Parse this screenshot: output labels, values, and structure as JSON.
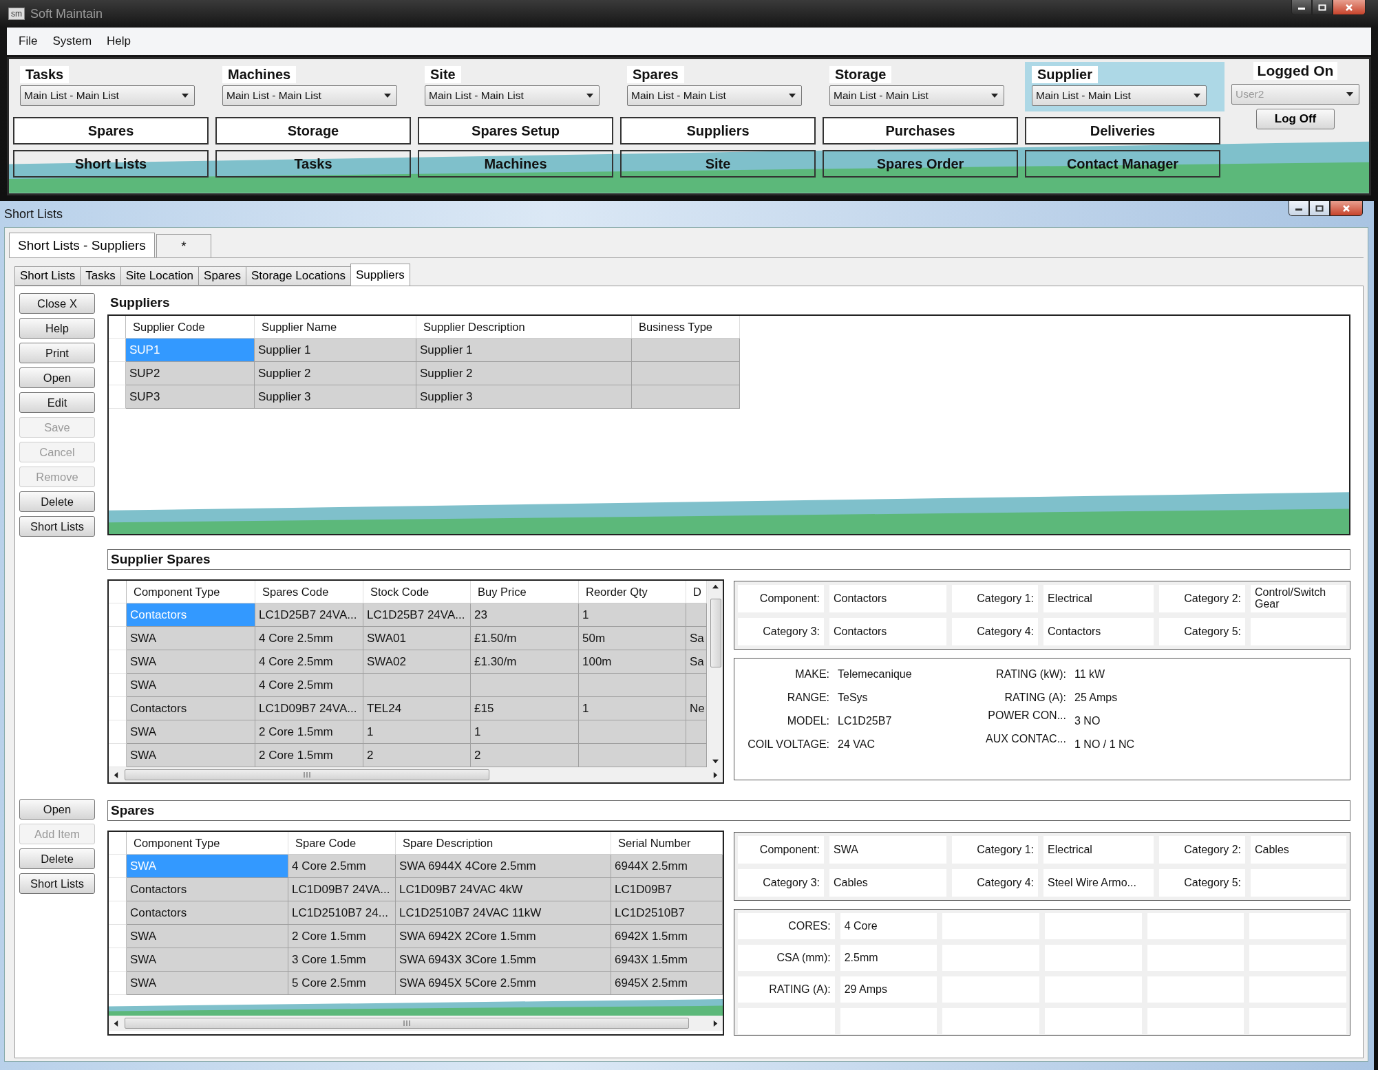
{
  "app_window": {
    "icon_text": "sm",
    "title": "Soft Maintain",
    "menu": [
      "File",
      "System",
      "Help"
    ]
  },
  "selectors": [
    {
      "label": "Tasks",
      "value": "Main List - Main List",
      "selected": false
    },
    {
      "label": "Machines",
      "value": "Main List - Main List",
      "selected": false
    },
    {
      "label": "Site",
      "value": "Main List - Main List",
      "selected": false
    },
    {
      "label": "Spares",
      "value": "Main List - Main List",
      "selected": false
    },
    {
      "label": "Storage",
      "value": "Main List  - Main List",
      "selected": false
    },
    {
      "label": "Supplier",
      "value": "Main List - Main List",
      "selected": true
    }
  ],
  "logged_on": {
    "label": "Logged On",
    "user": "User2",
    "button": "Log Off"
  },
  "nav_buttons_top": [
    "Spares",
    "Storage",
    "Spares Setup",
    "Suppliers",
    "Purchases",
    "Deliveries"
  ],
  "nav_buttons_bottom": [
    "Short Lists",
    "Tasks",
    "Machines",
    "Site",
    "Spares Order",
    "Contact Manager"
  ],
  "child_window": {
    "title": "Short Lists"
  },
  "doc_tabs": [
    {
      "label": "Short Lists - Suppliers",
      "selected": true
    },
    {
      "label": "*",
      "selected": false
    }
  ],
  "tabs": [
    {
      "label": "Short Lists",
      "selected": false
    },
    {
      "label": "Tasks",
      "selected": false
    },
    {
      "label": "Site Location",
      "selected": false
    },
    {
      "label": "Spares",
      "selected": false
    },
    {
      "label": "Storage Locations",
      "selected": false
    },
    {
      "label": "Suppliers",
      "selected": true
    }
  ],
  "side_buttons": [
    {
      "label": "Close X",
      "disabled": false
    },
    {
      "label": "Help",
      "disabled": false
    },
    {
      "label": "Print",
      "disabled": false
    },
    {
      "label": "Open",
      "disabled": false
    },
    {
      "label": "Edit",
      "disabled": false
    },
    {
      "label": "Save",
      "disabled": true
    },
    {
      "label": "Cancel",
      "disabled": true
    },
    {
      "label": "Remove",
      "disabled": true
    },
    {
      "label": "Delete",
      "disabled": false
    },
    {
      "label": "Short Lists",
      "disabled": false
    }
  ],
  "suppliers": {
    "title": "Suppliers",
    "columns": [
      "Supplier Code",
      "Supplier Name",
      "Supplier Description",
      "Business Type"
    ],
    "rows": [
      {
        "cells": [
          "SUP1",
          "Supplier 1",
          "Supplier 1",
          null
        ],
        "selected": true
      },
      {
        "cells": [
          "SUP2",
          "Supplier 2",
          "Supplier 2",
          null
        ],
        "selected": false
      },
      {
        "cells": [
          "SUP3",
          "Supplier 3",
          "Supplier 3",
          null
        ],
        "selected": false
      }
    ]
  },
  "supplier_spares": {
    "title": "Supplier Spares",
    "columns": [
      "Component Type",
      "Spares Code",
      "Stock Code",
      "Buy Price",
      "Reorder Qty",
      "D"
    ],
    "rows": [
      {
        "cells": [
          "Contactors",
          "LC1D25B7 24VA...",
          "LC1D25B7 24VA...",
          "23",
          "1",
          null
        ],
        "selected": true
      },
      {
        "cells": [
          "SWA",
          "4 Core 2.5mm",
          "SWA01",
          "£1.50/m",
          "50m",
          "Sa"
        ],
        "selected": false
      },
      {
        "cells": [
          "SWA",
          "4 Core 2.5mm",
          "SWA02",
          "£1.30/m",
          "100m",
          "Sa"
        ],
        "selected": false
      },
      {
        "cells": [
          "SWA",
          "4 Core 2.5mm",
          null,
          null,
          null,
          null
        ],
        "selected": false
      },
      {
        "cells": [
          "Contactors",
          "LC1D09B7 24VA...",
          "TEL24",
          "£15",
          "1",
          "Ne"
        ],
        "selected": false
      },
      {
        "cells": [
          "SWA",
          "2 Core 1.5mm",
          "1",
          "1",
          null,
          null
        ],
        "selected": false
      },
      {
        "cells": [
          "SWA",
          "2 Core 1.5mm",
          "2",
          "2",
          null,
          null
        ],
        "selected": false
      }
    ],
    "categories": [
      {
        "label": "Component:",
        "value": "Contactors"
      },
      {
        "label": "Category 1:",
        "value": "Electrical"
      },
      {
        "label": "Category 2:",
        "value": "Control/Switch Gear"
      },
      {
        "label": "Category 3:",
        "value": "Contactors"
      },
      {
        "label": "Category 4:",
        "value": "Contactors"
      },
      {
        "label": "Category 5:"
      }
    ],
    "attributes": [
      {
        "label": "MAKE:",
        "value": "Telemecanique"
      },
      {
        "label": "RATING (kW):",
        "value": "11 kW"
      },
      {
        "label": "RANGE:",
        "value": "TeSys"
      },
      {
        "label": "RATING (A):",
        "value": "25 Amps"
      },
      {
        "label": "MODEL:",
        "value": "LC1D25B7"
      },
      {
        "label": "POWER CON...",
        "value": "3 NO"
      },
      {
        "label": "COIL VOLTAGE:",
        "value": "24 VAC"
      },
      {
        "label": "AUX CONTAC...",
        "value": "1 NO / 1 NC"
      }
    ]
  },
  "spares": {
    "side_buttons": [
      {
        "label": "Open",
        "disabled": false
      },
      {
        "label": "Add Item",
        "disabled": true
      },
      {
        "label": "Delete",
        "disabled": false
      },
      {
        "label": "Short Lists",
        "disabled": false
      }
    ],
    "title": "Spares",
    "columns": [
      "Component Type",
      "Spare Code",
      "Spare Description",
      "Serial Number"
    ],
    "rows": [
      {
        "cells": [
          "SWA",
          "4 Core 2.5mm",
          "SWA 6944X 4Core 2.5mm",
          "6944X 2.5mm"
        ],
        "selected": true
      },
      {
        "cells": [
          "Contactors",
          "LC1D09B7 24VA...",
          "LC1D09B7 24VAC 4kW",
          "LC1D09B7"
        ],
        "selected": false
      },
      {
        "cells": [
          "Contactors",
          "LC1D2510B7 24...",
          "LC1D2510B7 24VAC 11kW",
          "LC1D2510B7"
        ],
        "selected": false
      },
      {
        "cells": [
          "SWA",
          "2 Core 1.5mm",
          "SWA 6942X 2Core 1.5mm",
          "6942X 1.5mm"
        ],
        "selected": false
      },
      {
        "cells": [
          "SWA",
          "3 Core 1.5mm",
          "SWA 6943X 3Core 1.5mm",
          "6943X 1.5mm"
        ],
        "selected": false
      },
      {
        "cells": [
          "SWA",
          "5 Core 2.5mm",
          "SWA 6945X 5Core 2.5mm",
          "6945X 2.5mm"
        ],
        "selected": false
      }
    ],
    "categories": [
      {
        "label": "Component:",
        "value": "SWA"
      },
      {
        "label": "Category 1:",
        "value": "Electrical"
      },
      {
        "label": "Category 2:",
        "value": "Cables"
      },
      {
        "label": "Category 3:",
        "value": "Cables"
      },
      {
        "label": "Category 4:",
        "value": "Steel Wire Armo..."
      },
      {
        "label": "Category 5:"
      }
    ],
    "attributes": [
      {
        "label": "CORES:",
        "value": "4 Core"
      },
      {
        "label": "CSA (mm):",
        "value": "2.5mm"
      },
      {
        "label": "RATING (A):",
        "value": "29 Amps"
      }
    ]
  }
}
